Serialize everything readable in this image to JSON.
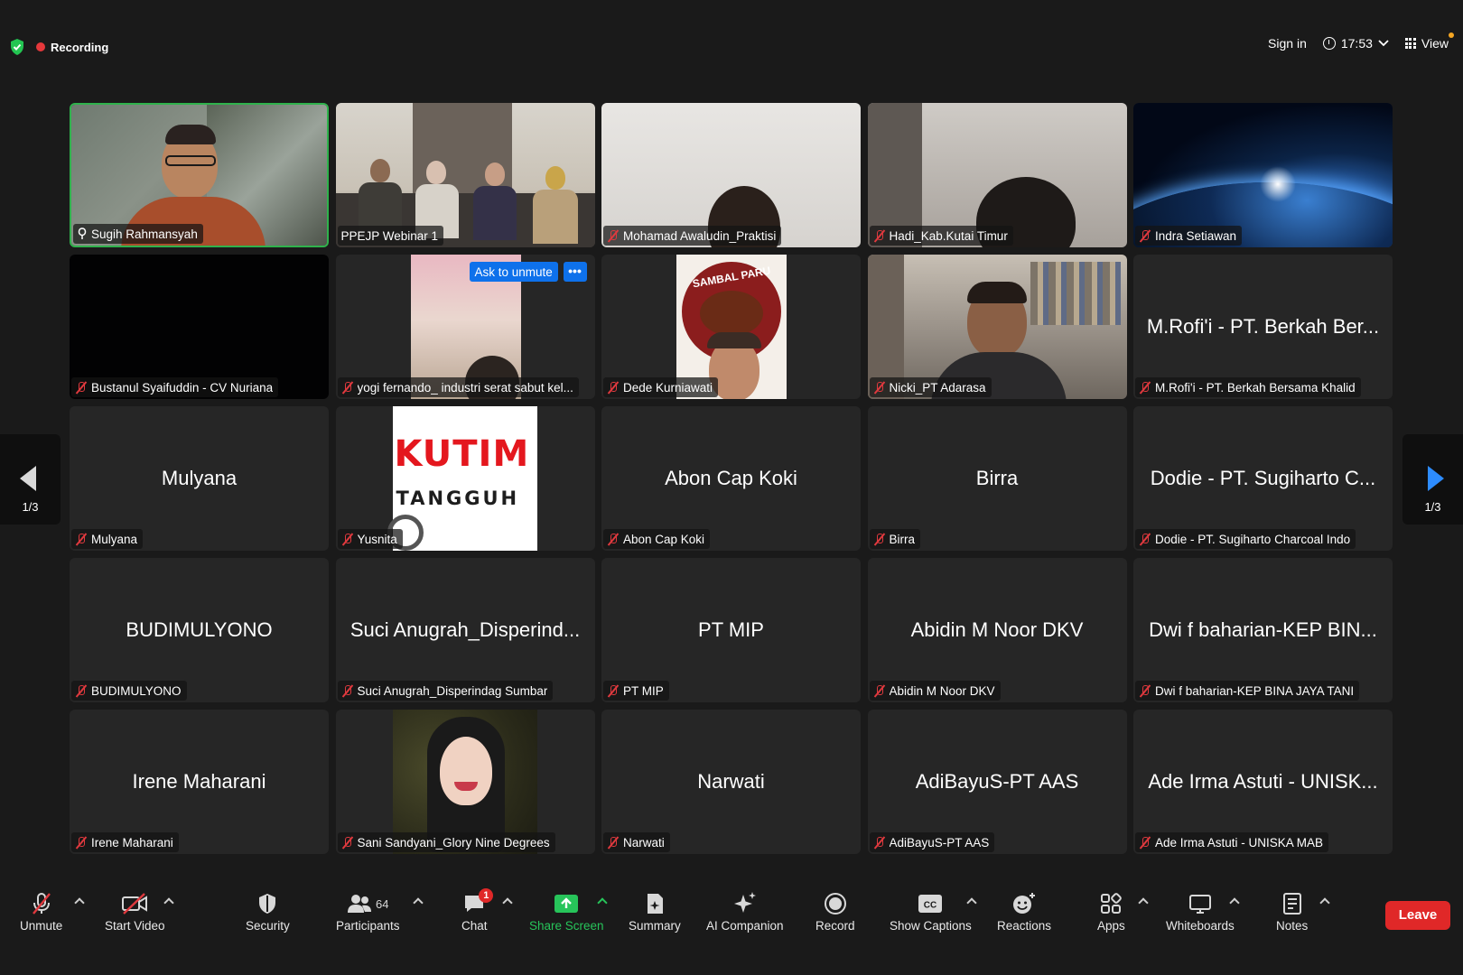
{
  "top": {
    "recording": "Recording",
    "sign_in": "Sign in",
    "time": "17:53",
    "view": "View"
  },
  "tiles": [
    {
      "name": "Sugih Rahmansyah",
      "type": "video",
      "active": true,
      "pinned": true
    },
    {
      "name": "PPEJP Webinar 1",
      "type": "video",
      "muted": false
    },
    {
      "name": "Mohamad Awaludin_Praktisi",
      "type": "video",
      "muted": true
    },
    {
      "name": "Hadi_Kab.Kutai Timur",
      "type": "video",
      "muted": true
    },
    {
      "name": "Indra Setiawan",
      "type": "video",
      "muted": true
    },
    {
      "name": "Bustanul Syaifuddin - CV Nuriana",
      "type": "video",
      "muted": true
    },
    {
      "name": "yogi fernando_ industri serat sabut kel...",
      "type": "video",
      "muted": true,
      "ask_to_unmute": "Ask to unmute",
      "more": "•••"
    },
    {
      "name": "Dede Kurniawati",
      "type": "video",
      "muted": true,
      "logo_text": "SAMBAL PARU"
    },
    {
      "name": "Nicki_PT Adarasa",
      "type": "video",
      "muted": true
    },
    {
      "name": "M.Rofi'i - PT. Berkah Bersama Khalid",
      "display": "M.Rofi'i - PT. Berkah Ber...",
      "type": "name",
      "muted": true
    },
    {
      "name": "Mulyana",
      "display": "Mulyana",
      "type": "name",
      "muted": true
    },
    {
      "name": "Yusnita",
      "type": "logo",
      "muted": true,
      "logo_line1": "KUTIM",
      "logo_line2": "TANGGUH"
    },
    {
      "name": "Abon Cap Koki",
      "display": "Abon Cap Koki",
      "type": "name",
      "muted": true
    },
    {
      "name": "Birra",
      "display": "Birra",
      "type": "name",
      "muted": true
    },
    {
      "name": "Dodie - PT. Sugiharto Charcoal Indo",
      "display": "Dodie - PT. Sugiharto C...",
      "type": "name",
      "muted": true
    },
    {
      "name": "BUDIMULYONO",
      "display": "BUDIMULYONO",
      "type": "name",
      "muted": true
    },
    {
      "name": "Suci Anugrah_Disperindag Sumbar",
      "display": "Suci Anugrah_Disperind...",
      "type": "name",
      "muted": true
    },
    {
      "name": "PT MIP",
      "display": "PT MIP",
      "type": "name",
      "muted": true
    },
    {
      "name": "Abidin M Noor DKV",
      "display": "Abidin M Noor DKV",
      "type": "name",
      "muted": true
    },
    {
      "name": "Dwi f baharian-KEP BINA JAYA TANI",
      "display": "Dwi f baharian-KEP BIN...",
      "type": "name",
      "muted": true
    },
    {
      "name": "Irene Maharani",
      "display": "Irene Maharani",
      "type": "name",
      "muted": true
    },
    {
      "name": "Sani Sandyani_Glory Nine Degrees",
      "type": "video",
      "muted": true
    },
    {
      "name": "Narwati",
      "display": "Narwati",
      "type": "name",
      "muted": true
    },
    {
      "name": "AdiBayuS-PT AAS",
      "display": "AdiBayuS-PT AAS",
      "type": "name",
      "muted": true
    },
    {
      "name": "Ade Irma Astuti - UNISKA MAB",
      "display": "Ade Irma Astuti - UNISK...",
      "type": "name",
      "muted": true
    }
  ],
  "pager": {
    "left": "1/3",
    "right": "1/3"
  },
  "toolbar": {
    "unmute": "Unmute",
    "start_video": "Start Video",
    "security": "Security",
    "participants": "Participants",
    "participants_count": "64",
    "chat": "Chat",
    "chat_badge": "1",
    "share_screen": "Share Screen",
    "summary": "Summary",
    "ai_companion": "AI Companion",
    "record": "Record",
    "show_captions": "Show Captions",
    "reactions": "Reactions",
    "apps": "Apps",
    "whiteboards": "Whiteboards",
    "notes": "Notes",
    "leave": "Leave"
  },
  "colors": {
    "accent": "#0e71eb",
    "active_border": "#2fb24c",
    "share": "#27c45a",
    "leave": "#e02828",
    "muted_mic": "#e0393e"
  }
}
